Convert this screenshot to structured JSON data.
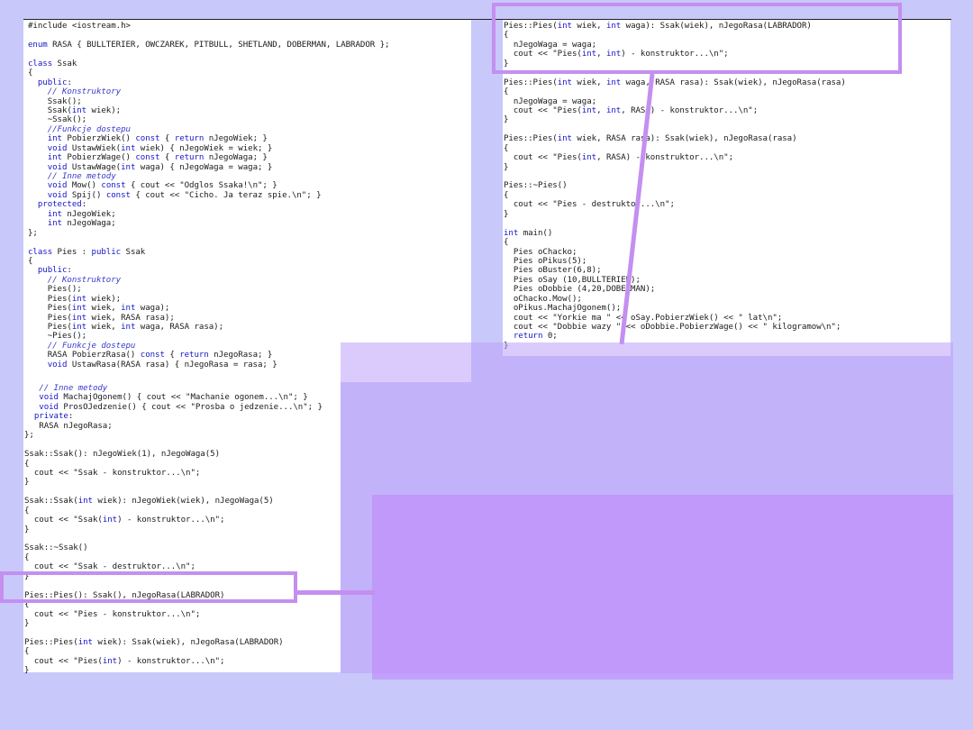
{
  "left_code": [
    "#include <iostream.h>",
    "",
    "enum RASA { BULLTERIER, OWCZAREK, PITBULL, SHETLAND, DOBERMAN, LABRADOR };",
    "",
    "class Ssak",
    "{",
    "  public:",
    "    // Konstruktory",
    "    Ssak();",
    "    Ssak(int wiek);",
    "    ~Ssak();",
    "    //Funkcje dostepu",
    "    int PobierzWiek() const { return nJegoWiek; }",
    "    void UstawWiek(int wiek) { nJegoWiek = wiek; }",
    "    int PobierzWage() const { return nJegoWaga; }",
    "    void UstawWage(int waga) { nJegoWaga = waga; }",
    "    // Inne metody",
    "    void Mow() const { cout << \"Odglos Ssaka!\\n\"; }",
    "    void Spij() const { cout << \"Cicho. Ja teraz spie.\\n\"; }",
    "  protected:",
    "    int nJegoWiek;",
    "    int nJegoWaga;",
    "};",
    "",
    "class Pies : public Ssak",
    "{",
    "  public:",
    "    // Konstruktory",
    "    Pies();",
    "    Pies(int wiek);",
    "    Pies(int wiek, int waga);",
    "    Pies(int wiek, RASA rasa);",
    "    Pies(int wiek, int waga, RASA rasa);",
    "    ~Pies();",
    "    // Funkcje dostepu",
    "    RASA PobierzRasa() const { return nJegoRasa; }",
    "    void UstawRasa(RASA rasa) { nJegoRasa = rasa; }"
  ],
  "left_bottom_code": [
    "   // Inne metody",
    "   void MachajOgonem() { cout << \"Machanie ogonem...\\n\"; }",
    "   void ProsOJedzenie() { cout << \"Prosba o jedzenie...\\n\"; }",
    "  private:",
    "   RASA nJegoRasa;",
    "};",
    "",
    "Ssak::Ssak(): nJegoWiek(1), nJegoWaga(5)",
    "{",
    "  cout << \"Ssak - konstruktor...\\n\";",
    "}",
    "",
    "Ssak::Ssak(int wiek): nJegoWiek(wiek), nJegoWaga(5)",
    "{",
    "  cout << \"Ssak(int) - konstruktor...\\n\";",
    "}",
    "",
    "Ssak::~Ssak()",
    "{",
    "  cout << \"Ssak - destruktor...\\n\";",
    "}",
    "",
    "Pies::Pies(): Ssak(), nJegoRasa(LABRADOR)",
    "{",
    "  cout << \"Pies - konstruktor...\\n\";",
    "}",
    "",
    "Pies::Pies(int wiek): Ssak(wiek), nJegoRasa(LABRADOR)",
    "{",
    "  cout << \"Pies(int) - konstruktor...\\n\";",
    "}"
  ],
  "right_code": [
    "Pies::Pies(int wiek, int waga): Ssak(wiek), nJegoRasa(LABRADOR)",
    "{",
    "  nJegoWaga = waga;",
    "  cout << \"Pies(int, int) - konstruktor...\\n\";",
    "}",
    "",
    "Pies::Pies(int wiek, int waga, RASA rasa): Ssak(wiek), nJegoRasa(rasa)",
    "{",
    "  nJegoWaga = waga;",
    "  cout << \"Pies(int, int, RASA) - konstruktor...\\n\";",
    "}",
    "",
    "Pies::Pies(int wiek, RASA rasa): Ssak(wiek), nJegoRasa(rasa)",
    "{",
    "  cout << \"Pies(int, RASA) - konstruktor...\\n\";",
    "}",
    "",
    "Pies::~Pies()",
    "{",
    "  cout << \"Pies - destruktor...\\n\";",
    "}",
    "",
    "int main()",
    "{",
    "  Pies oChacko;",
    "  Pies oPikus(5);",
    "  Pies oBuster(6,8);",
    "  Pies oSay (10,BULLTERIER);",
    "  Pies oDobbie (4,20,DOBERMAN);",
    "  oChacko.Mow();",
    "  oPikus.MachajOgonem();",
    "  cout << \"Yorkie ma \" << oSay.PobierzWiek() << \" lat\\n\";",
    "  cout << \"Dobbie wazy \" << oDobbie.PobierzWage() << \" kilogramow\\n\";",
    "  return 0;",
    "}"
  ],
  "colors": {
    "background": "#c8c8fb",
    "highlight": "#c48ff0",
    "keyword": "#1515c8",
    "comment": "#3a3acb"
  }
}
